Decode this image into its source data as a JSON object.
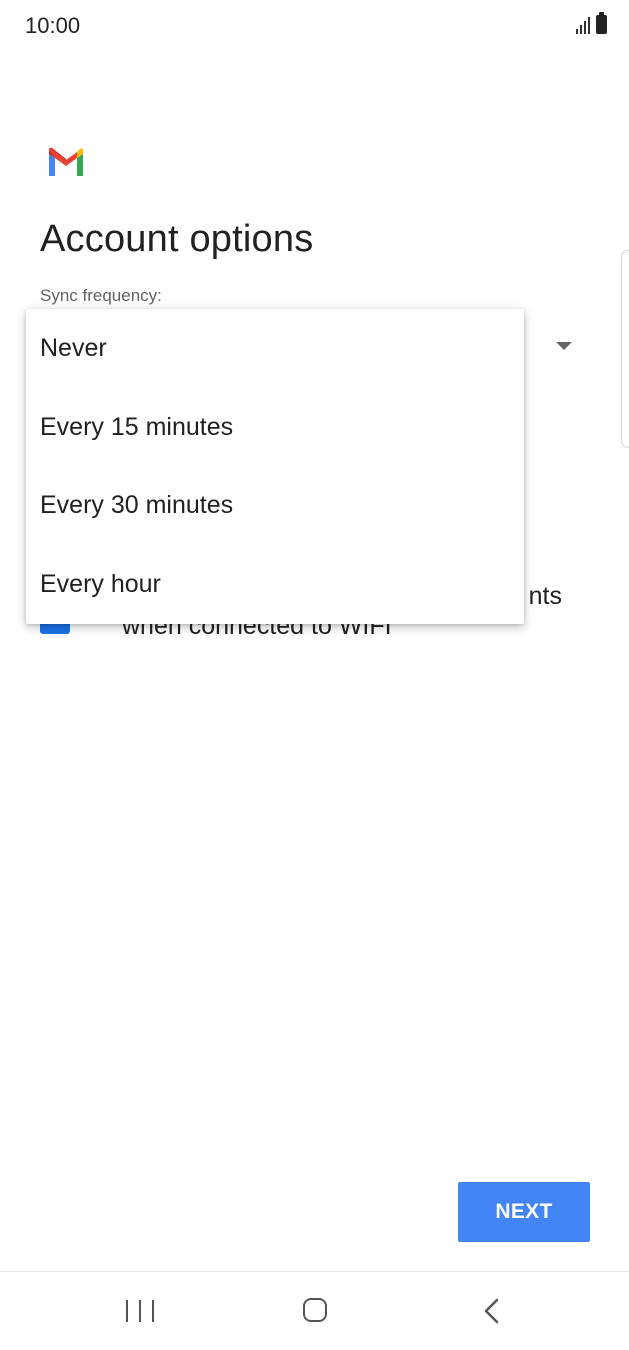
{
  "status_bar": {
    "time": "10:00"
  },
  "header": {
    "app_icon": "gmail-icon",
    "title": "Account options"
  },
  "sync": {
    "label": "Sync frequency:"
  },
  "dropdown": {
    "options": [
      "Never",
      "Every 15 minutes",
      "Every 30 minutes",
      "Every hour"
    ]
  },
  "background_option": {
    "text_line1_visible": "nts",
    "text_line2": "when connected to WIFI",
    "checked": true
  },
  "footer": {
    "next_label": "NEXT"
  },
  "nav_bar": {
    "icons": [
      "recents-icon",
      "home-icon",
      "back-icon"
    ]
  },
  "colors": {
    "primary": "#4285f4",
    "checkbox": "#1a73e8",
    "text": "#202124",
    "secondary_text": "#5f6368"
  }
}
